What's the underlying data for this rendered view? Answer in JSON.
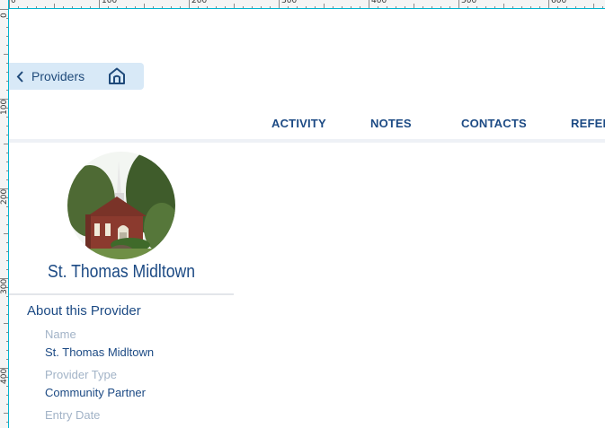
{
  "rulers": {
    "top_labels": [
      "0",
      "100",
      "200",
      "300",
      "400",
      "500",
      "600"
    ],
    "left_labels": [
      "0",
      "100",
      "200",
      "300",
      "400"
    ]
  },
  "nav": {
    "back_label": "Providers",
    "icons": {
      "back": "chevron-left-icon",
      "home": "home-icon"
    }
  },
  "tabs": [
    {
      "label": "ACTIVITY"
    },
    {
      "label": "NOTES"
    },
    {
      "label": "CONTACTS"
    },
    {
      "label": "REFER"
    }
  ],
  "provider": {
    "name": "St. Thomas Midltown",
    "photo": "church-photo"
  },
  "about": {
    "title": "About this Provider",
    "fields": [
      {
        "label": "Name",
        "value": "St. Thomas Midltown"
      },
      {
        "label": "Provider Type",
        "value": "Community Partner"
      },
      {
        "label": "Entry Date",
        "value": ""
      }
    ]
  },
  "colors": {
    "primary": "#1c4a84",
    "muted_label": "#a2b3c7",
    "nav_bg": "#d8e9f7",
    "ruler_guide": "#00b4d0"
  }
}
